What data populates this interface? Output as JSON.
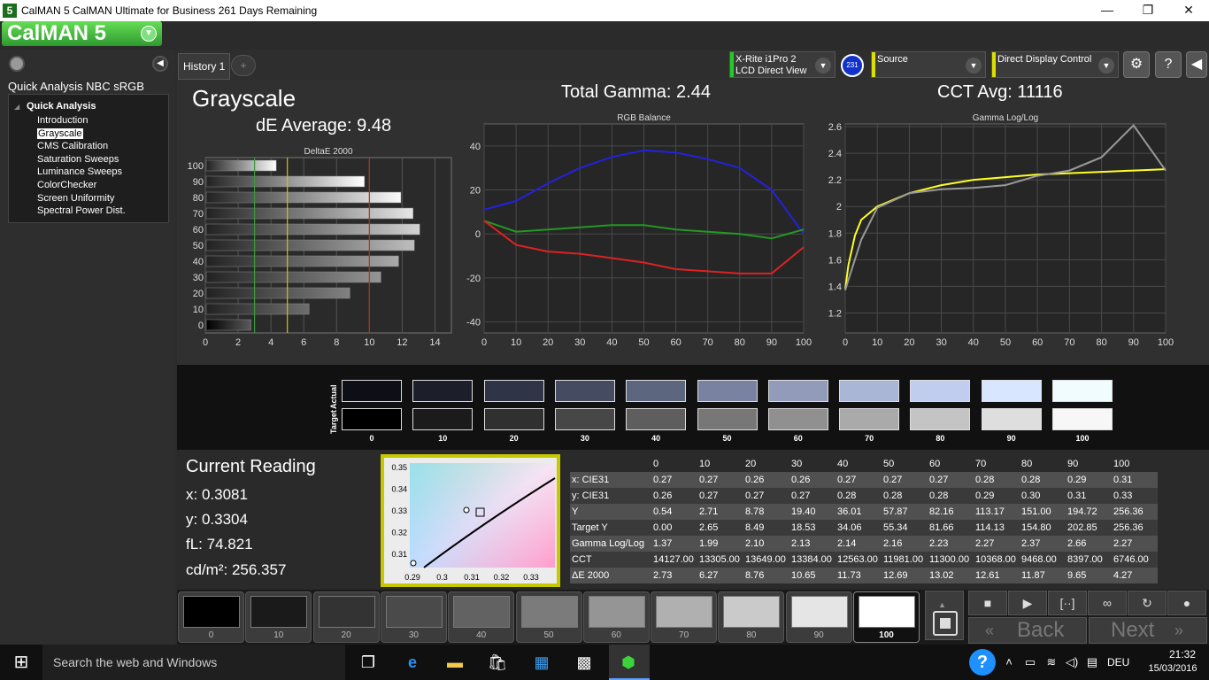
{
  "window": {
    "title": "CalMAN 5 CalMAN Ultimate for Business 261 Days Remaining",
    "app_icon": "5",
    "logo": "CalMAN 5"
  },
  "left": {
    "workflow_title": "Quick Analysis NBC sRGB",
    "tree_root": "Quick Analysis",
    "items": [
      "Introduction",
      "Grayscale",
      "CMS Calibration",
      "Saturation Sweeps",
      "Luminance Sweeps",
      "ColorChecker",
      "Screen Uniformity",
      "Spectral Power Dist."
    ],
    "selected": "Grayscale"
  },
  "tabs": {
    "history": "History 1",
    "add": "+"
  },
  "devices": {
    "meter_line1": "X-Rite i1Pro 2",
    "meter_line2": "LCD Direct View",
    "badge": "231",
    "source": "Source",
    "display": "Direct Display Control"
  },
  "headings": {
    "page": "Grayscale",
    "de_avg": "dE Average: 9.48",
    "gamma": "Total Gamma: 2.44",
    "cct": "CCT Avg: 11116"
  },
  "chart_data": [
    {
      "type": "bar",
      "title": "DeltaE 2000",
      "categories": [
        "0",
        "10",
        "20",
        "30",
        "40",
        "50",
        "60",
        "70",
        "80",
        "90",
        "100"
      ],
      "values": [
        2.73,
        6.27,
        8.76,
        10.65,
        11.73,
        12.69,
        13.02,
        12.61,
        11.87,
        9.65,
        4.27
      ],
      "xlim": [
        0,
        15
      ],
      "xticks": [
        "0",
        "2",
        "4",
        "6",
        "8",
        "10",
        "12",
        "14"
      ],
      "threshold_lines": [
        {
          "value": 3,
          "color": "#3a9a3a"
        },
        {
          "value": 5,
          "color": "#c8c800"
        },
        {
          "value": 10,
          "color": "#cc2222"
        }
      ]
    },
    {
      "type": "line",
      "title": "RGB Balance",
      "x": [
        0,
        10,
        20,
        30,
        40,
        50,
        60,
        70,
        80,
        90,
        100
      ],
      "xticks": [
        "0",
        "10",
        "20",
        "30",
        "40",
        "50",
        "60",
        "70",
        "80",
        "90",
        "100"
      ],
      "yticks": [
        "40",
        "20",
        "0",
        "-20",
        "-40"
      ],
      "ylim": [
        -45,
        50
      ],
      "series": [
        {
          "color": "#2222dd",
          "values": [
            11,
            15,
            23,
            30,
            35,
            38,
            37,
            34,
            30,
            20,
            0
          ]
        },
        {
          "color": "#229922",
          "values": [
            6,
            1,
            2,
            3,
            4,
            4,
            2,
            1,
            0,
            -2,
            2
          ]
        },
        {
          "color": "#dd2222",
          "values": [
            6,
            -5,
            -8,
            -9,
            -11,
            -13,
            -16,
            -17,
            -18,
            -18,
            -6
          ]
        }
      ]
    },
    {
      "type": "line",
      "title": "Gamma Log/Log",
      "x": [
        0,
        1,
        3,
        5,
        10,
        20,
        30,
        40,
        50,
        60,
        70,
        80,
        90,
        100
      ],
      "xticks": [
        "0",
        "10",
        "20",
        "30",
        "40",
        "50",
        "60",
        "70",
        "80",
        "90",
        "100"
      ],
      "yticks": [
        "2.6",
        "2.4",
        "2.2",
        "2",
        "1.8",
        "1.6",
        "1.4",
        "1.2"
      ],
      "ylim": [
        1.05,
        2.62
      ],
      "series": [
        {
          "color": "#ffff22",
          "values": [
            1.38,
            1.56,
            1.78,
            1.9,
            2.0,
            2.1,
            2.16,
            2.2,
            2.22,
            2.24,
            2.25,
            2.26,
            2.27,
            2.28
          ]
        },
        {
          "color": "#999999",
          "values": [
            1.37,
            1.45,
            1.6,
            1.75,
            1.99,
            2.1,
            2.13,
            2.14,
            2.16,
            2.23,
            2.27,
            2.37,
            2.61,
            2.27
          ]
        }
      ]
    }
  ],
  "strip": {
    "row_actual": "Actual",
    "row_target": "Target",
    "labels": [
      "0",
      "10",
      "20",
      "30",
      "40",
      "50",
      "60",
      "70",
      "80",
      "90",
      "100"
    ],
    "actual_colors": [
      "#0e0e16",
      "#1c1f2a",
      "#2f3446",
      "#454c62",
      "#5d667f",
      "#7982a0",
      "#939bbb",
      "#a9b6d6",
      "#c1cdef",
      "#d9e6ff",
      "#f1fcff"
    ],
    "target_colors": [
      "#000000",
      "#1b1b1b",
      "#303030",
      "#474747",
      "#5e5e5e",
      "#777777",
      "#909090",
      "#aaaaaa",
      "#c4c4c4",
      "#dedede",
      "#f7f7f7"
    ]
  },
  "reading": {
    "title": "Current Reading",
    "x": "x: 0.3081",
    "y": "y: 0.3304",
    "fl": "fL: 74.821",
    "cd": "cd/m²: 256.357"
  },
  "cie": {
    "xticks": [
      "0.29",
      "0.3",
      "0.31",
      "0.32",
      "0.33"
    ],
    "yticks": [
      "0.35",
      "0.34",
      "0.33",
      "0.32",
      "0.31"
    ]
  },
  "table": {
    "columns": [
      "",
      "0",
      "10",
      "20",
      "30",
      "40",
      "50",
      "60",
      "70",
      "80",
      "90",
      "100"
    ],
    "rows": [
      [
        "x: CIE31",
        "0.27",
        "0.27",
        "0.26",
        "0.26",
        "0.27",
        "0.27",
        "0.27",
        "0.28",
        "0.28",
        "0.29",
        "0.31"
      ],
      [
        "y: CIE31",
        "0.26",
        "0.27",
        "0.27",
        "0.27",
        "0.28",
        "0.28",
        "0.28",
        "0.29",
        "0.30",
        "0.31",
        "0.33"
      ],
      [
        "Y",
        "0.54",
        "2.71",
        "8.78",
        "19.40",
        "36.01",
        "57.87",
        "82.16",
        "113.17",
        "151.00",
        "194.72",
        "256.36"
      ],
      [
        "Target Y",
        "0.00",
        "2.65",
        "8.49",
        "18.53",
        "34.06",
        "55.34",
        "81.66",
        "114.13",
        "154.80",
        "202.85",
        "256.36"
      ],
      [
        "Gamma Log/Log",
        "1.37",
        "1.99",
        "2.10",
        "2.13",
        "2.14",
        "2.16",
        "2.23",
        "2.27",
        "2.37",
        "2.66",
        "2.27"
      ],
      [
        "CCT",
        "14127.00",
        "13305.00",
        "13649.00",
        "13384.00",
        "12563.00",
        "11981.00",
        "11300.00",
        "10368.00",
        "9468.00",
        "8397.00",
        "6746.00"
      ],
      [
        "ΔE 2000",
        "2.73",
        "6.27",
        "8.76",
        "10.65",
        "11.73",
        "12.69",
        "13.02",
        "12.61",
        "11.87",
        "9.65",
        "4.27"
      ]
    ]
  },
  "patches": {
    "labels": [
      "0",
      "10",
      "20",
      "30",
      "40",
      "50",
      "60",
      "70",
      "80",
      "90",
      "100"
    ],
    "colors": [
      "#000000",
      "#1a1a1a",
      "#333333",
      "#4a4a4a",
      "#626262",
      "#7b7b7b",
      "#959595",
      "#b0b0b0",
      "#cacaca",
      "#e5e5e5",
      "#ffffff"
    ],
    "selected": "100"
  },
  "nav": {
    "back": "Back",
    "next": "Next"
  },
  "taskbar": {
    "search": "Search the web and Windows",
    "lang": "DEU",
    "time": "21:32",
    "date": "15/03/2016"
  }
}
